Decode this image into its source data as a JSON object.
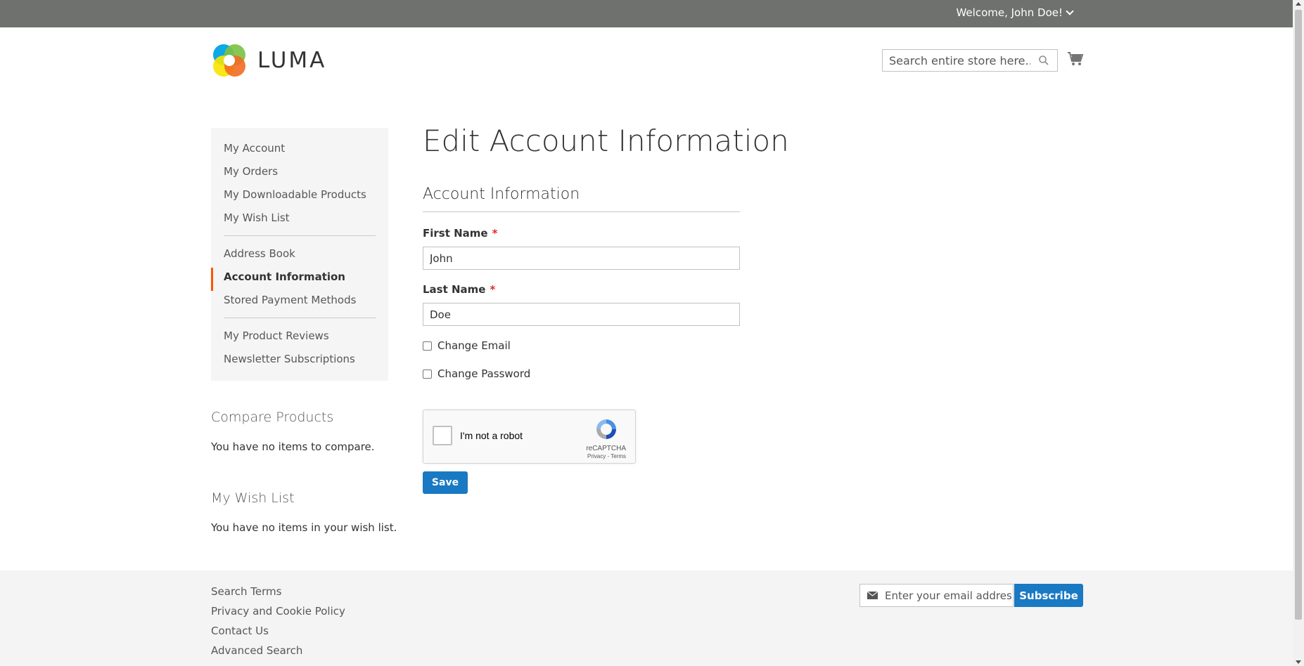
{
  "header": {
    "welcome": "Welcome, John Doe!",
    "logo_text": "LUMA",
    "search_placeholder": "Search entire store here...",
    "cart_icon": "cart-icon"
  },
  "sidebar": {
    "groups": [
      [
        "My Account",
        "My Orders",
        "My Downloadable Products",
        "My Wish List"
      ],
      [
        "Address Book",
        "Account Information",
        "Stored Payment Methods"
      ],
      [
        "My Product Reviews",
        "Newsletter Subscriptions"
      ]
    ],
    "items": [
      {
        "label": "My Account"
      },
      {
        "label": "My Orders"
      },
      {
        "label": "My Downloadable Products"
      },
      {
        "label": "My Wish List"
      },
      {
        "label": "Address Book"
      },
      {
        "label": "Account Information",
        "active": true
      },
      {
        "label": "Stored Payment Methods"
      },
      {
        "label": "My Product Reviews"
      },
      {
        "label": "Newsletter Subscriptions"
      }
    ],
    "active_color": "#ff5501",
    "compare": {
      "title": "Compare Products",
      "text": "You have no items to compare."
    },
    "wishlist": {
      "title": "My Wish List",
      "text": "You have no items in your wish list."
    }
  },
  "main": {
    "title": "Edit Account Information",
    "legend": "Account Information",
    "first_name": {
      "label": "First Name",
      "required": "*",
      "value": "John"
    },
    "last_name": {
      "label": "Last Name",
      "required": "*",
      "value": "Doe"
    },
    "change_email": {
      "label": "Change Email",
      "checked": false
    },
    "change_password": {
      "label": "Change Password",
      "checked": false
    },
    "recaptcha": {
      "label": "I'm not a robot",
      "brand": "reCAPTCHA",
      "links": "Privacy - Terms"
    },
    "save_label": "Save"
  },
  "footer": {
    "links": [
      "Search Terms",
      "Privacy and Cookie Policy",
      "Contact Us",
      "Advanced Search"
    ],
    "newsletter_placeholder": "Enter your email address",
    "subscribe_label": "Subscribe"
  },
  "colors": {
    "topbar": "#6e716e",
    "primary_button": "#1979c3",
    "required": "#e02b27"
  }
}
